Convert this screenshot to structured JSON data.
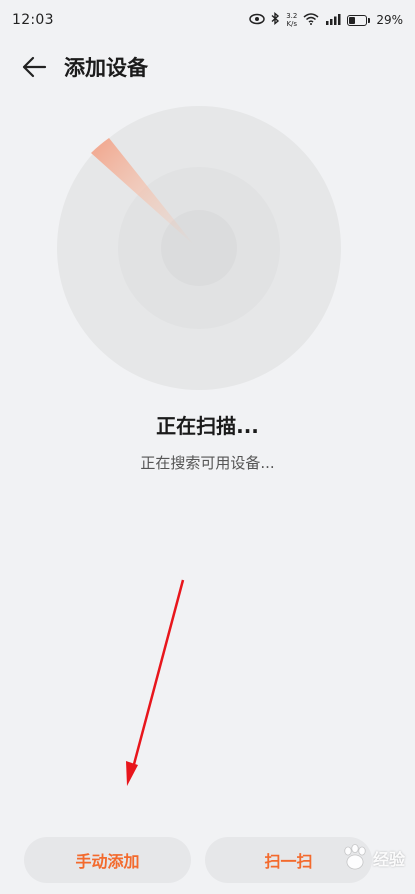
{
  "status_bar": {
    "time": "12:03",
    "net_speed_value": "3.2",
    "net_speed_unit": "K/s",
    "battery_percent": "29%",
    "battery_level": 0.29
  },
  "header": {
    "title": "添加设备"
  },
  "scan": {
    "title": "正在扫描...",
    "subtitle": "正在搜索可用设备..."
  },
  "buttons": {
    "manual_add": "手动添加",
    "scan_code": "扫一扫"
  },
  "watermark": {
    "text": "经验"
  },
  "colors": {
    "accent": "#f36a2d",
    "background": "#f1f2f4",
    "button_bg": "#e6e7e9",
    "annotation": "#e8161c"
  },
  "icons": [
    "back-arrow-icon",
    "eye-icon",
    "bluetooth-icon",
    "wifi-icon",
    "signal-icon",
    "battery-icon",
    "paw-logo-icon"
  ]
}
